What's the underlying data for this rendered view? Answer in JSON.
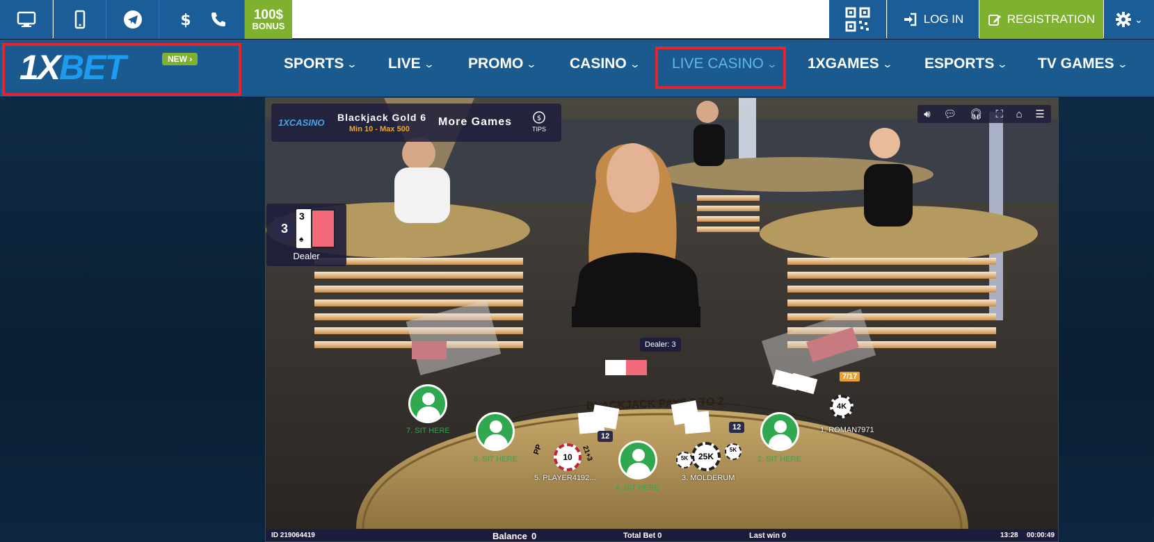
{
  "topbar": {
    "icons": [
      "desktop-icon",
      "mobile-icon",
      "telegram-icon",
      "dollar-icon",
      "phone-icon"
    ],
    "bonus_amount": "100$",
    "bonus_label": "BONUS",
    "login_label": "LOG IN",
    "register_label": "REGISTRATION"
  },
  "nav": {
    "logo_a": "1X",
    "logo_b": "BET",
    "new_badge": "NEW ›",
    "items": [
      "SPORTS",
      "LIVE",
      "PROMO",
      "CASINO",
      "LIVE CASINO",
      "1XGAMES",
      "ESPORTS",
      "TV GAMES"
    ],
    "active": "LIVE CASINO"
  },
  "game": {
    "casino_logo": "1XCASINO",
    "table_name": "Blackjack Gold 6",
    "limits": "Min 10 - Max 500",
    "more_games": "More Games",
    "tips": "TIPS",
    "dealer_score": "3",
    "dealer_card": "3",
    "dealer_label": "Dealer",
    "dealer_tag": "Dealer: 3",
    "seats": [
      {
        "label": "7. SIT HERE"
      },
      {
        "label": "6. SIT HERE"
      },
      {
        "label": "4. SIT HERE"
      },
      {
        "label": "2. SIT HERE"
      }
    ],
    "players": {
      "p1": "1. ROMAN7971",
      "p3": "3. MOLDERUM",
      "p5": "5. PLAYER4192..."
    },
    "badge_a": "12",
    "badge_b": "12",
    "chip_10": "10",
    "chip_25k": "25K",
    "chip_5k_a": "5K",
    "chip_5k_b": "5K",
    "chip_4k": "4K",
    "score_717": "7/17",
    "pp": "PP",
    "side_213": "21+3",
    "table_text": "BLACKJACK PAYS 3 TO 2",
    "status": {
      "id": "ID 219064419",
      "balance_label": "Balance",
      "balance_value": "0",
      "total_bet": "Total Bet 0",
      "last_win": "Last win 0",
      "time": "13:28",
      "elapsed": "00:00:49"
    }
  },
  "colors": {
    "brand_blue": "#1a5d98",
    "nav_blue": "#1a5a8f",
    "green": "#7fb130",
    "highlight_red": "#e8232c",
    "active_nav": "#5cb8f0"
  }
}
